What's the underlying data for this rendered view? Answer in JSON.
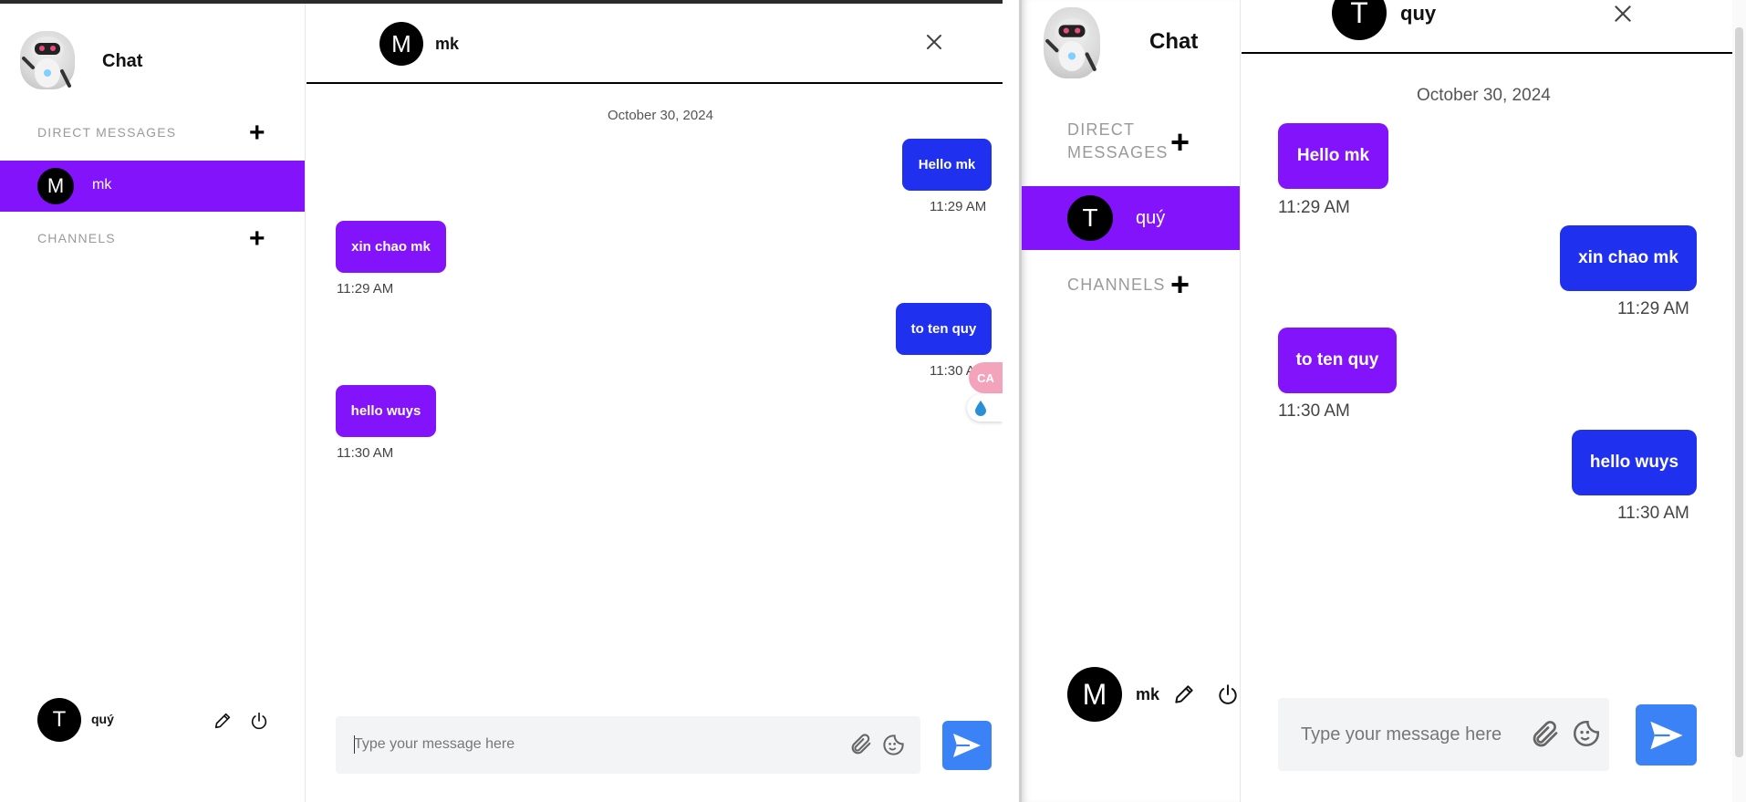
{
  "left": {
    "sidebar": {
      "title": "Chat",
      "direct_messages_label": "DIRECT MESSAGES",
      "channels_label": "CHANNELS",
      "contacts": [
        {
          "initial": "M",
          "name": "mk"
        }
      ],
      "user": {
        "initial": "T",
        "name": "quý"
      }
    },
    "header": {
      "initial": "M",
      "name": "mk"
    },
    "date": "October 30, 2024",
    "messages": [
      {
        "text": "Hello mk",
        "time": "11:29 AM"
      },
      {
        "text": "xin chao mk",
        "time": "11:29 AM"
      },
      {
        "text": "to ten quy",
        "time": "11:30 AM"
      },
      {
        "text": "hello wuys",
        "time": "11:30 AM"
      }
    ],
    "input_placeholder": "Type your message here",
    "floating_badge": "CA"
  },
  "right": {
    "sidebar": {
      "title": "Chat",
      "direct_messages_label": "DIRECT MESSAGES",
      "channels_label": "CHANNELS",
      "contacts": [
        {
          "initial": "T",
          "name": "quý"
        }
      ],
      "user": {
        "initial": "M",
        "name": "mk"
      }
    },
    "header": {
      "initial": "T",
      "name": "quy"
    },
    "date": "October 30, 2024",
    "messages": [
      {
        "text": "Hello mk",
        "time": "11:29 AM"
      },
      {
        "text": "xin chao mk",
        "time": "11:29 AM"
      },
      {
        "text": "to ten quy",
        "time": "11:30 AM"
      },
      {
        "text": "hello wuys",
        "time": "11:30 AM"
      }
    ],
    "input_placeholder": "Type your message here"
  },
  "colors": {
    "purple": "#8313fb",
    "blue": "#1f31ef",
    "send": "#3b82f6"
  },
  "icons": [
    "robot-logo",
    "plus-icon",
    "close-icon",
    "pencil-icon",
    "power-icon",
    "paperclip-icon",
    "sticker-icon",
    "send-icon"
  ]
}
